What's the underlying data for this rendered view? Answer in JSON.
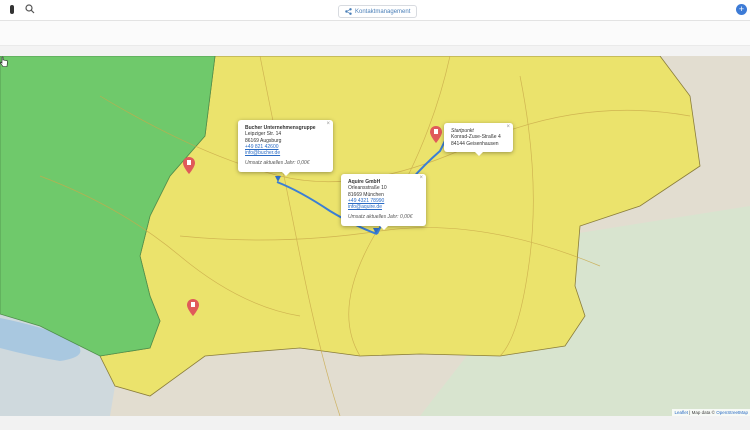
{
  "header": {
    "menu_icon": "menu-icon",
    "search_icon": "search-icon",
    "center_button": {
      "label": "Kontaktmanagement",
      "icon": "share-icon"
    },
    "add_icon": "plus-icon"
  },
  "map": {
    "colors": {
      "green_region": "#6cc86a",
      "yellow_region": "#eae36a",
      "route": "#3b7fd4",
      "marker": "#e05a5a"
    },
    "attribution": {
      "leaflet": "Leaflet",
      "separator": " | Map data © ",
      "osm": "OpenStreetMap"
    },
    "popups": [
      {
        "name": "Bucher Unternehmensgruppe",
        "street": "Leipziger Str. 14",
        "city": "86169 Augsburg",
        "phone": "+49 821 42600",
        "email": "info@bucher.de",
        "revenue": "Umsatz aktuelles Jahr: 0,00€"
      },
      {
        "name": "Aquire GmbH",
        "street": "Orleansstraße 10",
        "city": "81669 München",
        "phone": "+49 4321 78990",
        "email": "info@aquire.de",
        "revenue": "Umsatz aktuelles Jahr: 0,00€"
      },
      {
        "name": "Startpunkt",
        "street": "Konrad-Zuse-Straße 4",
        "city": "84144 Geisenhausen"
      }
    ]
  }
}
